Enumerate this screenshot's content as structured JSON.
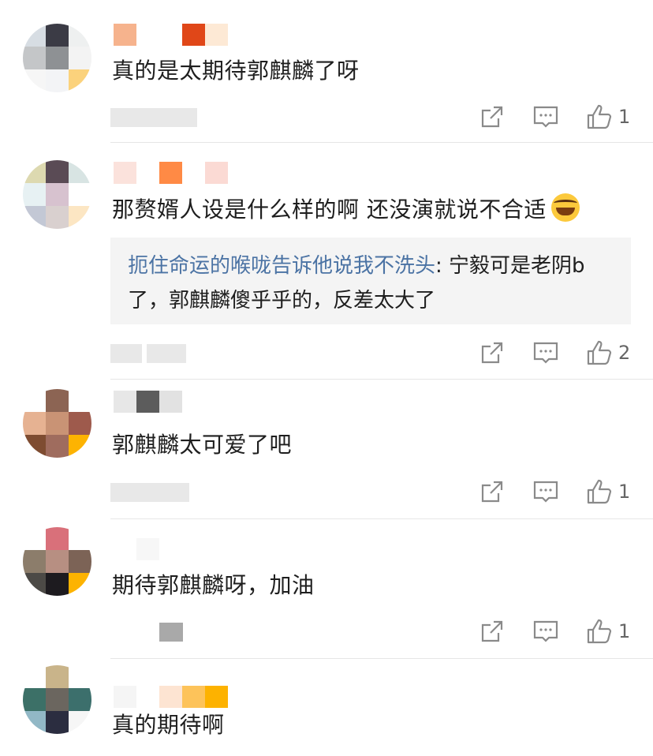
{
  "comments": [
    {
      "text": "真的是太期待郭麒麟了呀",
      "likes": "1",
      "avatar_colors": [
        "#d7dde3",
        "#3b3b45",
        "#eef0f0",
        "#c4c6c8",
        "#8e9194",
        "#f3f3f3",
        "#f6f6f6",
        "#f3f4f6",
        "#fbd27c"
      ],
      "name_colors": [
        "#f6b38d",
        "#ffffff",
        "#ffffff",
        "#e04718",
        "#fde9d5"
      ]
    },
    {
      "text": "那赘婿人设是什么样的啊 还没演就说不合适",
      "likes": "2",
      "reply_user": "扼住命运的喉咙告诉他说我不洗头",
      "reply_text": ": 宁毅可是老阴b了，郭麒麟傻乎乎的，反差太大了",
      "avatar_colors": [
        "#ddd9b0",
        "#5a4b55",
        "#d8e4e3",
        "#e7f1f3",
        "#d7c2cf",
        "#ffffff",
        "#c3c8d5",
        "#d9d0cf",
        "#fce6c3"
      ],
      "name_colors": [
        "#fbe2dc",
        "#ffffff",
        "#ff8a45",
        "#ffffff",
        "#fbdad4"
      ]
    },
    {
      "text": "郭麒麟太可爱了吧",
      "likes": "1",
      "avatar_colors": [
        "#ffffff",
        "#8c6453",
        "#ffffff",
        "#e6b292",
        "#c99375",
        "#9e5a4c",
        "#7e4c31",
        "#9f6c5e",
        "#fdb301"
      ],
      "name_colors": [
        "#e7e7e7",
        "#5c5c5c",
        "#e2e2e2",
        "#ffffff",
        "#ffffff"
      ]
    },
    {
      "text": "期待郭麒麟呀，加油",
      "likes": "1",
      "avatar_colors": [
        "#ffffff",
        "#d9707a",
        "#ffffff",
        "#8c7d6b",
        "#b78f82",
        "#7c6356",
        "#4c4a46",
        "#1d1b1f",
        "#fdb301"
      ],
      "name_colors": [
        "#ffffff",
        "#f7f7f7",
        "#ffffff",
        "#ffffff",
        "#ffffff"
      ]
    },
    {
      "text": "真的期待啊",
      "likes": "",
      "avatar_colors": [
        "#ffffff",
        "#c9b48a",
        "#ffffff",
        "#3c7067",
        "#6b665f",
        "#3c6f6c",
        "#92b8c6",
        "#2b2d40",
        "#f6f6f6"
      ],
      "name_colors": [
        "#f5f5f5",
        "#ffffff",
        "#fde4d2",
        "#fdc35a",
        "#fdb200"
      ]
    }
  ],
  "icons": {
    "share": "share-icon",
    "comment": "comment-icon",
    "like": "thumbs-up-icon",
    "emoji": "laughing-crying-emoji"
  }
}
